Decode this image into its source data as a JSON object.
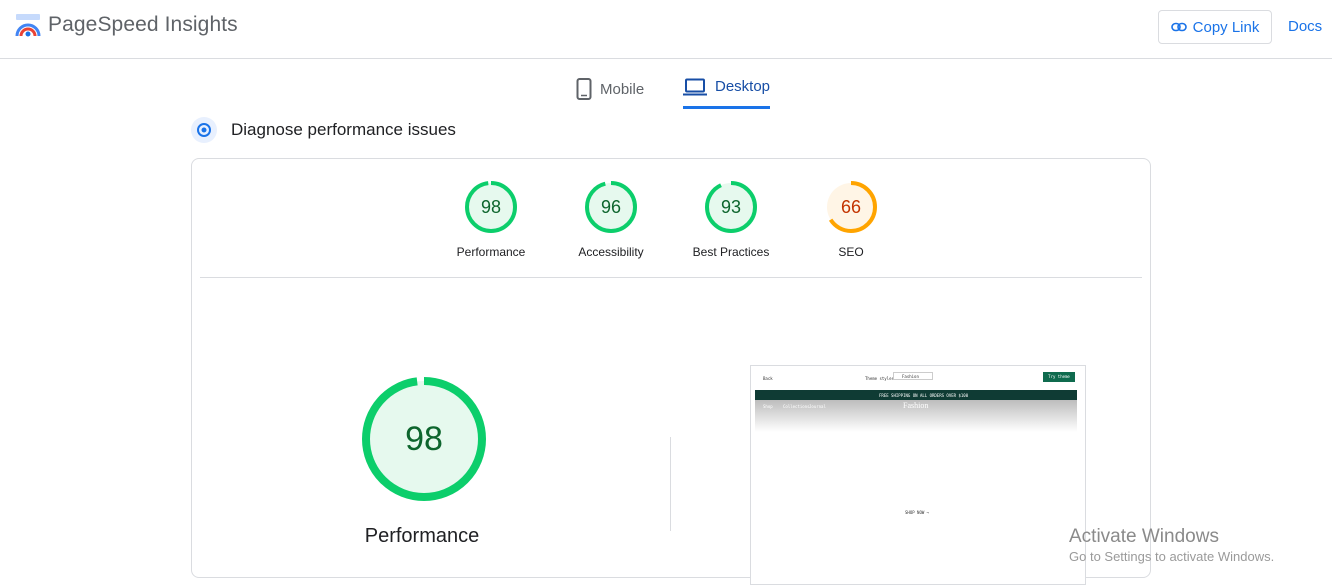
{
  "app": {
    "title": "PageSpeed Insights"
  },
  "header": {
    "copy_link": "Copy Link",
    "docs": "Docs"
  },
  "tabs": [
    {
      "label": "Mobile"
    },
    {
      "label": "Desktop"
    }
  ],
  "diagnose": {
    "title": "Diagnose performance issues"
  },
  "scores": [
    {
      "value": "98",
      "label": "Performance",
      "fraction": 0.98,
      "color": "#0cce6b",
      "text_color": "#0d652d",
      "bg": "#e6f9ee"
    },
    {
      "value": "96",
      "label": "Accessibility",
      "fraction": 0.96,
      "color": "#0cce6b",
      "text_color": "#0d652d",
      "bg": "#e6f9ee"
    },
    {
      "value": "93",
      "label": "Best Practices",
      "fraction": 0.93,
      "color": "#0cce6b",
      "text_color": "#0d652d",
      "bg": "#e6f9ee"
    },
    {
      "value": "66",
      "label": "SEO",
      "fraction": 0.66,
      "color": "#ffa400",
      "text_color": "#c33300",
      "bg": "#fff5e6"
    }
  ],
  "main_score": {
    "value": "98",
    "label": "Performance",
    "fraction": 0.98
  },
  "screenshot": {
    "back": "Back",
    "theme_label": "Theme styles",
    "theme_value": "Fashion",
    "button": "Try theme",
    "banner": "FREE SHIPPING ON ALL ORDERS OVER $100",
    "brand": "Fashion",
    "nav": [
      "Shop",
      "Collections",
      "Journal"
    ],
    "center_text": "SHOP NOW →"
  },
  "watermark": {
    "title": "Activate Windows",
    "subtitle": "Go to Settings to activate Windows."
  }
}
